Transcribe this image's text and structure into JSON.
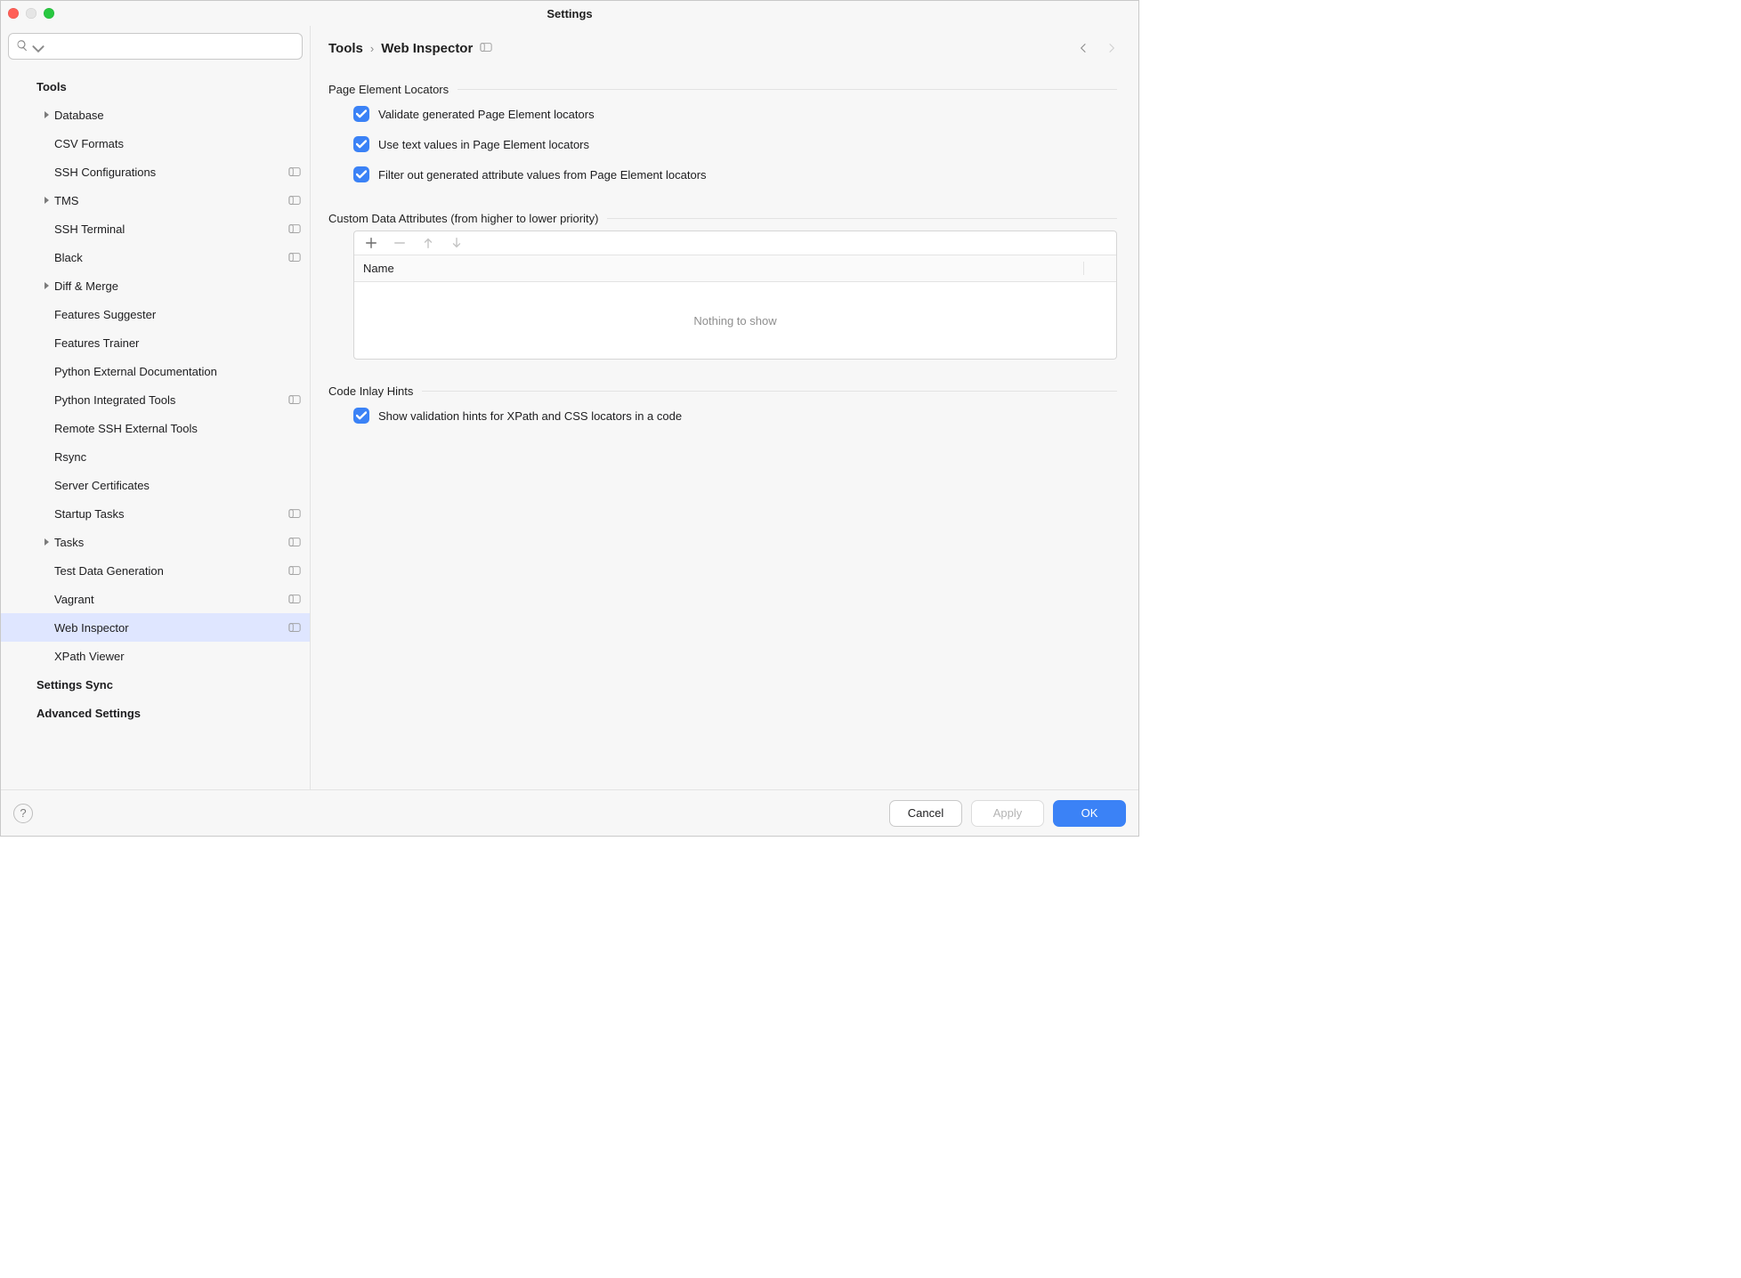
{
  "window": {
    "title": "Settings"
  },
  "search": {
    "placeholder": ""
  },
  "breadcrumb": {
    "parent": "Tools",
    "separator": "›",
    "current": "Web Inspector"
  },
  "tree": {
    "sections": [
      {
        "label": "Tools",
        "level": 0,
        "bold": true,
        "expandable": false,
        "badge": false
      },
      {
        "label": "Database",
        "level": 1,
        "expandable": true,
        "badge": false
      },
      {
        "label": "CSV Formats",
        "level": 1,
        "expandable": false,
        "badge": false
      },
      {
        "label": "SSH Configurations",
        "level": 1,
        "expandable": false,
        "badge": true
      },
      {
        "label": "TMS",
        "level": 1,
        "expandable": true,
        "badge": true
      },
      {
        "label": "SSH Terminal",
        "level": 1,
        "expandable": false,
        "badge": true
      },
      {
        "label": "Black",
        "level": 1,
        "expandable": false,
        "badge": true
      },
      {
        "label": "Diff & Merge",
        "level": 1,
        "expandable": true,
        "badge": false
      },
      {
        "label": "Features Suggester",
        "level": 1,
        "expandable": false,
        "badge": false
      },
      {
        "label": "Features Trainer",
        "level": 1,
        "expandable": false,
        "badge": false
      },
      {
        "label": "Python External Documentation",
        "level": 1,
        "expandable": false,
        "badge": false
      },
      {
        "label": "Python Integrated Tools",
        "level": 1,
        "expandable": false,
        "badge": true
      },
      {
        "label": "Remote SSH External Tools",
        "level": 1,
        "expandable": false,
        "badge": false
      },
      {
        "label": "Rsync",
        "level": 1,
        "expandable": false,
        "badge": false
      },
      {
        "label": "Server Certificates",
        "level": 1,
        "expandable": false,
        "badge": false
      },
      {
        "label": "Startup Tasks",
        "level": 1,
        "expandable": false,
        "badge": true
      },
      {
        "label": "Tasks",
        "level": 1,
        "expandable": true,
        "badge": true
      },
      {
        "label": "Test Data Generation",
        "level": 1,
        "expandable": false,
        "badge": true
      },
      {
        "label": "Vagrant",
        "level": 1,
        "expandable": false,
        "badge": true
      },
      {
        "label": "Web Inspector",
        "level": 1,
        "expandable": false,
        "badge": true,
        "selected": true
      },
      {
        "label": "XPath Viewer",
        "level": 1,
        "expandable": false,
        "badge": false
      },
      {
        "label": "Settings Sync",
        "level": 0,
        "bold": true,
        "expandable": false,
        "badge": false
      },
      {
        "label": "Advanced Settings",
        "level": 0,
        "bold": true,
        "expandable": false,
        "badge": false
      }
    ]
  },
  "sections": {
    "pel": {
      "title": "Page Element Locators",
      "options": [
        {
          "label": "Validate generated Page Element locators",
          "checked": true
        },
        {
          "label": "Use text values in Page Element locators",
          "checked": true
        },
        {
          "label": "Filter out generated attribute values from Page Element locators",
          "checked": true
        }
      ]
    },
    "cda": {
      "title": "Custom Data Attributes (from higher to lower priority)",
      "column": "Name",
      "empty": "Nothing to show"
    },
    "cih": {
      "title": "Code Inlay Hints",
      "options": [
        {
          "label": "Show validation hints for XPath and CSS locators in a code",
          "checked": true
        }
      ]
    }
  },
  "footer": {
    "cancel": "Cancel",
    "apply": "Apply",
    "ok": "OK"
  }
}
